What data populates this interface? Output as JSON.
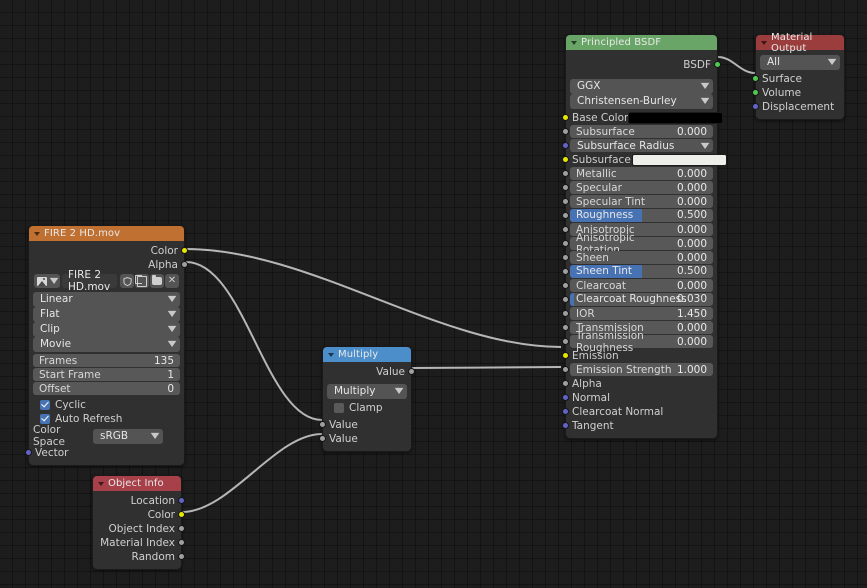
{
  "editor": {
    "background": "#1d1d1d",
    "grid_size_px": 13
  },
  "socket_colors": {
    "color": "#e6e600",
    "value": "#9f9f9f",
    "vector": "#6363c7",
    "shader": "#4fca4f"
  },
  "nodes": {
    "image_texture": {
      "title": "FIRE 2 HD.mov",
      "header_color": "#c07030",
      "outputs": [
        {
          "label": "Color",
          "socket": "color"
        },
        {
          "label": "Alpha",
          "socket": "value"
        }
      ],
      "datablock": {
        "icon": "image-icon",
        "browse_icon": "chevron-down-icon",
        "name": "FIRE 2 HD.mov",
        "fake_user_icon": "shield-icon",
        "new_icon": "copy-icon",
        "open_icon": "folder-icon",
        "unlink_icon": "close-icon"
      },
      "dropdowns": [
        {
          "name": "interpolation",
          "value": "Linear"
        },
        {
          "name": "projection",
          "value": "Flat"
        },
        {
          "name": "extension",
          "value": "Clip"
        },
        {
          "name": "source",
          "value": "Movie"
        }
      ],
      "numbers": [
        {
          "label": "Frames",
          "value": "135"
        },
        {
          "label": "Start Frame",
          "value": "1"
        },
        {
          "label": "Offset",
          "value": "0"
        }
      ],
      "checkboxes": [
        {
          "label": "Cyclic",
          "checked": true
        },
        {
          "label": "Auto Refresh",
          "checked": true
        }
      ],
      "color_space": {
        "label": "Color Space",
        "value": "sRGB"
      },
      "inputs": [
        {
          "label": "Vector",
          "socket": "vector"
        }
      ]
    },
    "object_info": {
      "title": "Object Info",
      "header_color": "#a8404a",
      "outputs": [
        {
          "label": "Location",
          "socket": "vector"
        },
        {
          "label": "Color",
          "socket": "color"
        },
        {
          "label": "Object Index",
          "socket": "value"
        },
        {
          "label": "Material Index",
          "socket": "value"
        },
        {
          "label": "Random",
          "socket": "value"
        }
      ]
    },
    "multiply": {
      "title": "Multiply",
      "header_color": "#4b8ec9",
      "outputs": [
        {
          "label": "Value",
          "socket": "value"
        }
      ],
      "operation": "Multiply",
      "clamp": {
        "label": "Clamp",
        "checked": false
      },
      "inputs": [
        {
          "label": "Value",
          "socket": "value"
        },
        {
          "label": "Value",
          "socket": "value"
        }
      ]
    },
    "principled_bsdf": {
      "title": "Principled BSDF",
      "header_color": "#69a567",
      "outputs": [
        {
          "label": "BSDF",
          "socket": "shader"
        }
      ],
      "dropdowns": [
        {
          "name": "distribution",
          "value": "GGX"
        },
        {
          "name": "subsurface-method",
          "value": "Christensen-Burley"
        }
      ],
      "properties": [
        {
          "label": "Base Color",
          "kind": "color",
          "socket": "color",
          "swatch": "#000000"
        },
        {
          "label": "Subsurface",
          "kind": "number",
          "socket": "value",
          "value": "0.000"
        },
        {
          "label": "Subsurface Radius",
          "kind": "menu",
          "socket": "vector"
        },
        {
          "label": "Subsurface C...",
          "kind": "color",
          "socket": "color",
          "swatch": "#eeeeea"
        },
        {
          "label": "Metallic",
          "kind": "number",
          "socket": "value",
          "value": "0.000"
        },
        {
          "label": "Specular",
          "kind": "number",
          "socket": "value",
          "value": "0.000"
        },
        {
          "label": "Specular Tint",
          "kind": "number",
          "socket": "value",
          "value": "0.000"
        },
        {
          "label": "Roughness",
          "kind": "slider",
          "socket": "value",
          "value": "0.500",
          "fill_pct": 50
        },
        {
          "label": "Anisotropic",
          "kind": "number",
          "socket": "value",
          "value": "0.000"
        },
        {
          "label": "Anisotropic Rotation",
          "kind": "number",
          "socket": "value",
          "value": "0.000"
        },
        {
          "label": "Sheen",
          "kind": "number",
          "socket": "value",
          "value": "0.000"
        },
        {
          "label": "Sheen Tint",
          "kind": "slider",
          "socket": "value",
          "value": "0.500",
          "fill_pct": 50
        },
        {
          "label": "Clearcoat",
          "kind": "number",
          "socket": "value",
          "value": "0.000"
        },
        {
          "label": "Clearcoat Roughness",
          "kind": "slider",
          "socket": "value",
          "value": "0.030",
          "fill_pct": 3
        },
        {
          "label": "IOR",
          "kind": "number",
          "socket": "value",
          "value": "1.450"
        },
        {
          "label": "Transmission",
          "kind": "number",
          "socket": "value",
          "value": "0.000"
        },
        {
          "label": "Transmission Roughness",
          "kind": "number",
          "socket": "value",
          "value": "0.000"
        },
        {
          "label": "Emission",
          "kind": "plain",
          "socket": "color"
        },
        {
          "label": "Emission Strength",
          "kind": "number",
          "socket": "value",
          "value": "1.000"
        },
        {
          "label": "Alpha",
          "kind": "plain",
          "socket": "value"
        },
        {
          "label": "Normal",
          "kind": "plain",
          "socket": "vector"
        },
        {
          "label": "Clearcoat Normal",
          "kind": "plain",
          "socket": "vector"
        },
        {
          "label": "Tangent",
          "kind": "plain",
          "socket": "vector"
        }
      ]
    },
    "material_output": {
      "title": "Material Output",
      "header_color": "#9b3d3d",
      "target": "All",
      "inputs": [
        {
          "label": "Surface",
          "socket": "shader"
        },
        {
          "label": "Volume",
          "socket": "shader"
        },
        {
          "label": "Displacement",
          "socket": "vector"
        }
      ]
    }
  },
  "links": [
    {
      "from": "image-texture.Color",
      "to": "principled-bsdf.Emission"
    },
    {
      "from": "image-texture.Alpha",
      "to": "multiply.Value1"
    },
    {
      "from": "object-info.Color",
      "to": "multiply.Value2"
    },
    {
      "from": "multiply.Value",
      "to": "principled-bsdf.Alpha"
    },
    {
      "from": "principled-bsdf.BSDF",
      "to": "material-output.Surface"
    }
  ]
}
